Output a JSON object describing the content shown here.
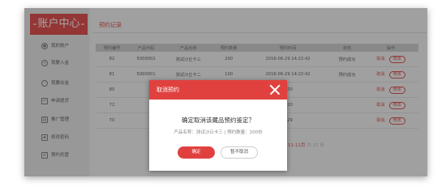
{
  "sidebar": {
    "title": "账户中心",
    "items": [
      {
        "label": "我的账户",
        "icon": "user-icon"
      },
      {
        "label": "我要入金",
        "icon": "deposit-icon"
      },
      {
        "label": "我要出金",
        "icon": "withdraw-icon"
      },
      {
        "label": "申请提货",
        "icon": "pickup-icon"
      },
      {
        "label": "推广管理",
        "icon": "promotion-icon"
      },
      {
        "label": "修改密码",
        "icon": "lock-icon"
      },
      {
        "label": "预约托管",
        "icon": "document-icon"
      }
    ]
  },
  "main": {
    "title": "预约记录",
    "table": {
      "headers": [
        "预约编号",
        "产品代码",
        "产品名称",
        "预约数量",
        "预约时间",
        "状态",
        "操作"
      ],
      "rows": [
        {
          "id": "82",
          "code": "5000002",
          "name": "测试沙丘卡三",
          "qty": "200",
          "time": "2016-06-29 14:22:42",
          "status": "预约成功",
          "cancel": "取消",
          "modify": "修改"
        },
        {
          "id": "81",
          "code": "5000001",
          "name": "测试沙丘卡二",
          "qty": "100",
          "time": "2016-06-29 14:22:42",
          "status": "预约成功",
          "cancel": "取消",
          "modify": "修改"
        },
        {
          "id": "80",
          "code": "",
          "name": "",
          "qty": "",
          "time": "...20",
          "status": "",
          "cancel": "取消",
          "modify": "修改"
        },
        {
          "id": "72",
          "code": "",
          "name": "",
          "qty": "",
          "time": "...20",
          "status": "",
          "cancel": "取消",
          "modify": "修改"
        },
        {
          "id": "70",
          "code": "",
          "name": "",
          "qty": "",
          "time": "...29",
          "status": "",
          "cancel": "取消",
          "modify": "修改"
        }
      ]
    },
    "pager": {
      "pages": "11-11页",
      "total": "共 15 条"
    }
  },
  "modal": {
    "title": "取消预约",
    "message": "确定取消该藏品预约鉴定？",
    "product_info": "产品名称：测试沙丘卡三 | 预约数量：200份",
    "ok_label": "确定",
    "no_label": "暂不取消"
  },
  "colors": {
    "accent": "#e0413f",
    "sidebar": "#e9e9e9",
    "table_header": "#cfcfcf"
  }
}
